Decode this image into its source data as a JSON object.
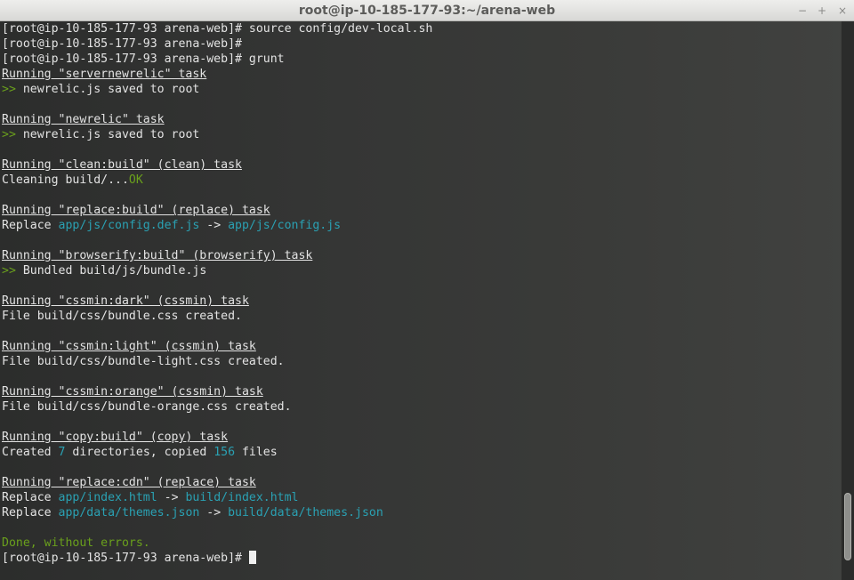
{
  "window": {
    "title": "root@ip-10-185-177-93:~/arena-web",
    "buttons": {
      "minimize": "−",
      "maximize": "+",
      "close": "×"
    }
  },
  "colors": {
    "prompt_text": "#e3e3e3",
    "success_green": "#6aa01c",
    "path_cyan": "#2aa1b3"
  },
  "terminal": {
    "prompt": "[root@ip-10-185-177-93 arena-web]#",
    "cmd_source": " source config/dev-local.sh",
    "cmd_grunt": " grunt",
    "arrow": ">>",
    "t_servernewrelic": "Running \"servernewrelic\" task",
    "newrelic_saved": " newrelic.js saved to root",
    "t_newrelic": "Running \"newrelic\" task",
    "t_clean": "Running \"clean:build\" (clean) task",
    "cleaning": "Cleaning build/...",
    "ok": "OK",
    "t_replace": "Running \"replace:build\" (replace) task",
    "replace_label": "Replace ",
    "replace_arrow": " -> ",
    "r1_src": "app/js/config.def.js",
    "r1_dst": "app/js/config.js",
    "t_browserify": "Running \"browserify:build\" (browserify) task",
    "bundled": " Bundled build/js/bundle.js",
    "t_cssmin_dark": "Running \"cssmin:dark\" (cssmin) task",
    "file_dark": "File build/css/bundle.css created.",
    "t_cssmin_light": "Running \"cssmin:light\" (cssmin) task",
    "file_light": "File build/css/bundle-light.css created.",
    "t_cssmin_orange": "Running \"cssmin:orange\" (cssmin) task",
    "file_orange": "File build/css/bundle-orange.css created.",
    "t_copy": "Running \"copy:build\" (copy) task",
    "created_label": "Created ",
    "dir_count": "7",
    "dirs_mid": " directories, copied ",
    "file_count": "156",
    "files_tail": " files",
    "t_cdn": "Running \"replace:cdn\" (replace) task",
    "r2_src": "app/index.html",
    "r2_dst": "build/index.html",
    "r3_src": "app/data/themes.json",
    "r3_dst": "build/data/themes.json",
    "done": "Done, without errors."
  }
}
